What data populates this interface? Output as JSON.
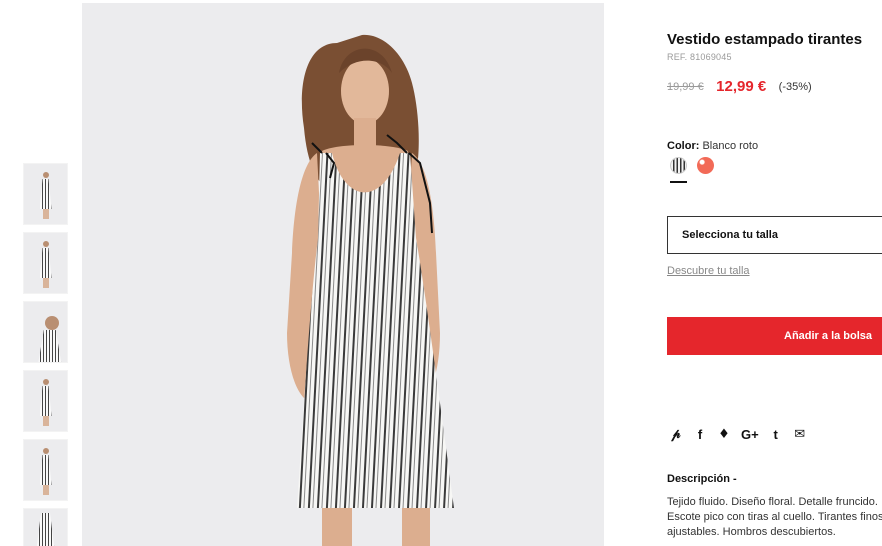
{
  "product": {
    "title": "Vestido estampado tirantes",
    "ref": "REF. 81069045",
    "old_price": "19,99 €",
    "new_price": "12,99 €",
    "discount": "(-35%)",
    "price_color": "#e5262c"
  },
  "color": {
    "label": "Color:",
    "value": "Blanco roto",
    "swatches": [
      "striped",
      "coral"
    ]
  },
  "size": {
    "select_label": "Selecciona tu talla",
    "guide_link": "Descubre tu talla"
  },
  "cart": {
    "add_label": "Añadir a la bolsa",
    "button_color": "#e5262c"
  },
  "social": {
    "icons": [
      "pinterest-icon",
      "facebook-icon",
      "twitter-icon",
      "google-plus-icon",
      "tumblr-icon",
      "email-icon"
    ],
    "glyphs": [
      "℗",
      "f",
      "🐦",
      "G+",
      "t",
      "✉"
    ]
  },
  "description": {
    "title": "Descripción -",
    "text": "Tejido fluido. Diseño floral. Detalle fruncido. Escote pico con tiras al cuello. Tirantes finos ajustables. Hombros descubiertos."
  },
  "gallery": {
    "thumbnails_count": 6
  }
}
